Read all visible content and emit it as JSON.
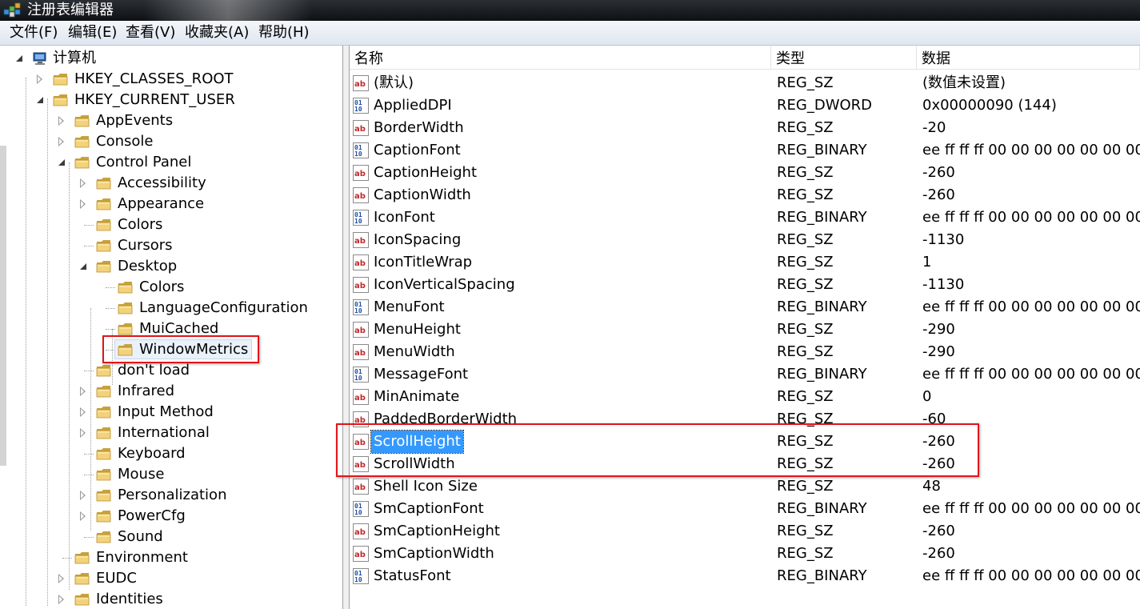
{
  "window": {
    "title": "注册表编辑器"
  },
  "menu": [
    "文件(F)",
    "编辑(E)",
    "查看(V)",
    "收藏夹(A)",
    "帮助(H)"
  ],
  "tree": {
    "root": "计算机",
    "nodes": [
      {
        "label": "HKEY_CLASSES_ROOT",
        "state": "collapsed"
      },
      {
        "label": "HKEY_CURRENT_USER",
        "state": "expanded"
      },
      {
        "label": "AppEvents",
        "state": "collapsed"
      },
      {
        "label": "Console",
        "state": "collapsed"
      },
      {
        "label": "Control Panel",
        "state": "expanded"
      },
      {
        "label": "Accessibility",
        "state": "collapsed"
      },
      {
        "label": "Appearance",
        "state": "collapsed"
      },
      {
        "label": "Colors",
        "state": "leaf"
      },
      {
        "label": "Cursors",
        "state": "leaf"
      },
      {
        "label": "Desktop",
        "state": "expanded"
      },
      {
        "label": "Colors",
        "state": "leaf"
      },
      {
        "label": "LanguageConfiguration",
        "state": "leaf"
      },
      {
        "label": "MuiCached",
        "state": "leaf"
      },
      {
        "label": "WindowMetrics",
        "state": "selected"
      },
      {
        "label": "don't load",
        "state": "leaf"
      },
      {
        "label": "Infrared",
        "state": "collapsed"
      },
      {
        "label": "Input Method",
        "state": "collapsed"
      },
      {
        "label": "International",
        "state": "collapsed"
      },
      {
        "label": "Keyboard",
        "state": "leaf"
      },
      {
        "label": "Mouse",
        "state": "leaf"
      },
      {
        "label": "Personalization",
        "state": "collapsed"
      },
      {
        "label": "PowerCfg",
        "state": "collapsed"
      },
      {
        "label": "Sound",
        "state": "leaf"
      },
      {
        "label": "Environment",
        "state": "leaf"
      },
      {
        "label": "EUDC",
        "state": "collapsed"
      },
      {
        "label": "Identities",
        "state": "collapsed"
      }
    ]
  },
  "list": {
    "headers": {
      "name": "名称",
      "type": "类型",
      "data": "数据"
    },
    "rows": [
      {
        "icon": "string-value-icon",
        "name": "(默认)",
        "type": "REG_SZ",
        "data": "(数值未设置)"
      },
      {
        "icon": "binary-value-icon",
        "name": "AppliedDPI",
        "type": "REG_DWORD",
        "data": "0x00000090 (144)"
      },
      {
        "icon": "string-value-icon",
        "name": "BorderWidth",
        "type": "REG_SZ",
        "data": "-20"
      },
      {
        "icon": "binary-value-icon",
        "name": "CaptionFont",
        "type": "REG_BINARY",
        "data": "ee ff ff ff 00 00 00 00 00 00 00 00"
      },
      {
        "icon": "string-value-icon",
        "name": "CaptionHeight",
        "type": "REG_SZ",
        "data": "-260"
      },
      {
        "icon": "string-value-icon",
        "name": "CaptionWidth",
        "type": "REG_SZ",
        "data": "-260"
      },
      {
        "icon": "binary-value-icon",
        "name": "IconFont",
        "type": "REG_BINARY",
        "data": "ee ff ff ff 00 00 00 00 00 00 00 00"
      },
      {
        "icon": "string-value-icon",
        "name": "IconSpacing",
        "type": "REG_SZ",
        "data": "-1130"
      },
      {
        "icon": "string-value-icon",
        "name": "IconTitleWrap",
        "type": "REG_SZ",
        "data": "1"
      },
      {
        "icon": "string-value-icon",
        "name": "IconVerticalSpacing",
        "type": "REG_SZ",
        "data": "-1130"
      },
      {
        "icon": "binary-value-icon",
        "name": "MenuFont",
        "type": "REG_BINARY",
        "data": "ee ff ff ff 00 00 00 00 00 00 00 00"
      },
      {
        "icon": "string-value-icon",
        "name": "MenuHeight",
        "type": "REG_SZ",
        "data": "-290"
      },
      {
        "icon": "string-value-icon",
        "name": "MenuWidth",
        "type": "REG_SZ",
        "data": "-290"
      },
      {
        "icon": "binary-value-icon",
        "name": "MessageFont",
        "type": "REG_BINARY",
        "data": "ee ff ff ff 00 00 00 00 00 00 00 00"
      },
      {
        "icon": "string-value-icon",
        "name": "MinAnimate",
        "type": "REG_SZ",
        "data": "0"
      },
      {
        "icon": "string-value-icon",
        "name": "PaddedBorderWidth",
        "type": "REG_SZ",
        "data": "-60"
      },
      {
        "icon": "string-value-icon",
        "name": "ScrollHeight",
        "type": "REG_SZ",
        "data": "-260",
        "selected": true
      },
      {
        "icon": "string-value-icon",
        "name": "ScrollWidth",
        "type": "REG_SZ",
        "data": "-260"
      },
      {
        "icon": "string-value-icon",
        "name": "Shell Icon Size",
        "type": "REG_SZ",
        "data": "48"
      },
      {
        "icon": "binary-value-icon",
        "name": "SmCaptionFont",
        "type": "REG_BINARY",
        "data": "ee ff ff ff 00 00 00 00 00 00 00 00"
      },
      {
        "icon": "string-value-icon",
        "name": "SmCaptionHeight",
        "type": "REG_SZ",
        "data": "-260"
      },
      {
        "icon": "string-value-icon",
        "name": "SmCaptionWidth",
        "type": "REG_SZ",
        "data": "-260"
      },
      {
        "icon": "binary-value-icon",
        "name": "StatusFont",
        "type": "REG_BINARY",
        "data": "ee ff ff ff 00 00 00 00 00 00 00 00"
      }
    ]
  },
  "colors": {
    "selection": "#3399ff",
    "annotation_box": "#e0161b",
    "folder": "#e8c060"
  }
}
